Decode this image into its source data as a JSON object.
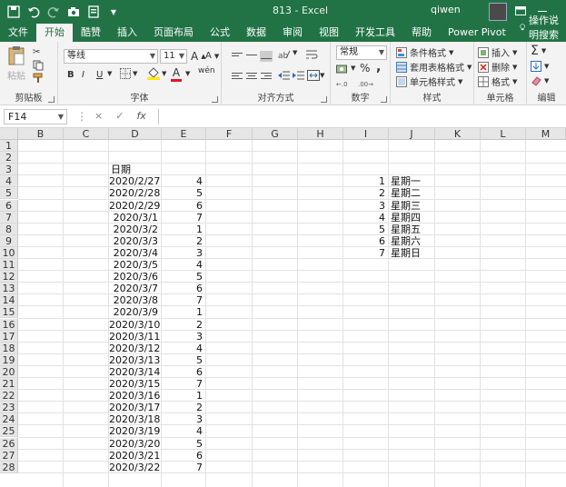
{
  "window": {
    "title": "813  -  Excel",
    "user": "qiwen"
  },
  "qat_icons": [
    "save-icon",
    "undo-icon",
    "redo-icon",
    "camera-icon",
    "form-icon"
  ],
  "tabs": [
    "文件",
    "开始",
    "酷赞",
    "插入",
    "页面布局",
    "公式",
    "数据",
    "审阅",
    "视图",
    "开发工具",
    "帮助",
    "Power Pivot"
  ],
  "active_tab": "开始",
  "tell_me": "操作说明搜索",
  "ribbon": {
    "clipboard": {
      "paste": "粘贴",
      "label": "剪贴板"
    },
    "font": {
      "name": "等线",
      "size": "11",
      "bold": "B",
      "italic": "I",
      "underline": "U",
      "label": "字体",
      "grow": "A",
      "shrink": "A",
      "color_a": "A",
      "wen": "wén"
    },
    "alignment": {
      "label": "对齐方式"
    },
    "number": {
      "format": "常规",
      "percent": "%",
      "comma": ",",
      "label": "数字"
    },
    "styles": {
      "conditional": "条件格式",
      "table": "套用表格格式",
      "cell": "单元格样式",
      "label": "样式"
    },
    "cells": {
      "insert": "插入",
      "delete": "删除",
      "format": "格式",
      "label": "单元格"
    },
    "editing": {
      "sum": "Σ",
      "label": "编辑"
    }
  },
  "formula_bar": {
    "name_box": "F14",
    "cancel": "×",
    "enter": "✓",
    "fx": "fx",
    "value": ""
  },
  "columns": [
    "B",
    "C",
    "D",
    "E",
    "F",
    "G",
    "H",
    "I",
    "J",
    "K",
    "L",
    "M"
  ],
  "rows": [
    "1",
    "2",
    "3",
    "4",
    "5",
    "6",
    "7",
    "8",
    "9",
    "10",
    "11",
    "12",
    "13",
    "14",
    "15",
    "16",
    "17",
    "18",
    "19",
    "20",
    "21",
    "22",
    "23",
    "24",
    "25",
    "26",
    "27",
    "28"
  ],
  "sheet": {
    "header_d3": "日期",
    "dates": [
      "2020/2/27",
      "2020/2/28",
      "2020/2/29",
      "2020/3/1",
      "2020/3/2",
      "2020/3/3",
      "2020/3/4",
      "2020/3/5",
      "2020/3/6",
      "2020/3/7",
      "2020/3/8",
      "2020/3/9",
      "2020/3/10",
      "2020/3/11",
      "2020/3/12",
      "2020/3/13",
      "2020/3/14",
      "2020/3/15",
      "2020/3/16",
      "2020/3/17",
      "2020/3/18",
      "2020/3/19",
      "2020/3/20",
      "2020/3/21",
      "2020/3/22"
    ],
    "weekdays": [
      "4",
      "5",
      "6",
      "7",
      "1",
      "2",
      "3",
      "4",
      "5",
      "6",
      "7",
      "1",
      "2",
      "3",
      "4",
      "5",
      "6",
      "7",
      "1",
      "2",
      "3",
      "4",
      "5",
      "6",
      "7"
    ],
    "lookup_nums": [
      "1",
      "2",
      "3",
      "4",
      "5",
      "6",
      "7"
    ],
    "lookup_names": [
      "星期一",
      "星期二",
      "星期三",
      "星期四",
      "星期五",
      "星期六",
      "星期日"
    ]
  },
  "colors": {
    "brand": "#217346",
    "ribbon_bg": "#f3f3f3"
  }
}
